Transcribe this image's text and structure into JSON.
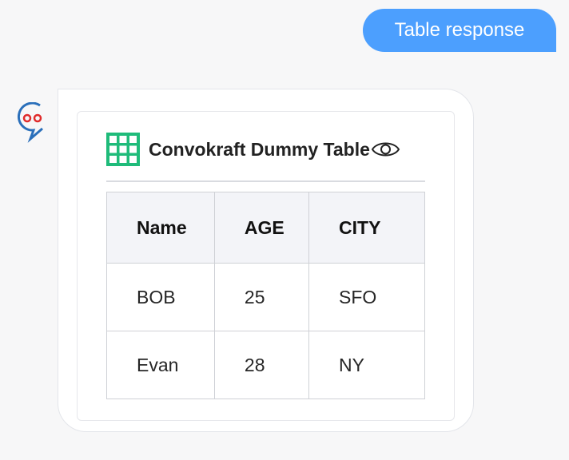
{
  "user_message": {
    "text": "Table response",
    "color": "#4c9ffe"
  },
  "bot": {
    "avatar_icon": "chat-bot-icon",
    "card": {
      "title": "Convokraft Dummy Table",
      "title_icon": "table-grid-icon",
      "action_icon": "eye-icon",
      "table": {
        "columns": [
          "Name",
          "AGE",
          "CITY"
        ],
        "rows": [
          [
            "BOB",
            "25",
            "SFO"
          ],
          [
            "Evan",
            "28",
            "NY"
          ]
        ]
      }
    }
  },
  "colors": {
    "accent": "#4c9ffe",
    "grid_icon": "#1fbb7a",
    "avatar_ring": "#2a6fba",
    "avatar_eyes": "#e02b2b"
  }
}
